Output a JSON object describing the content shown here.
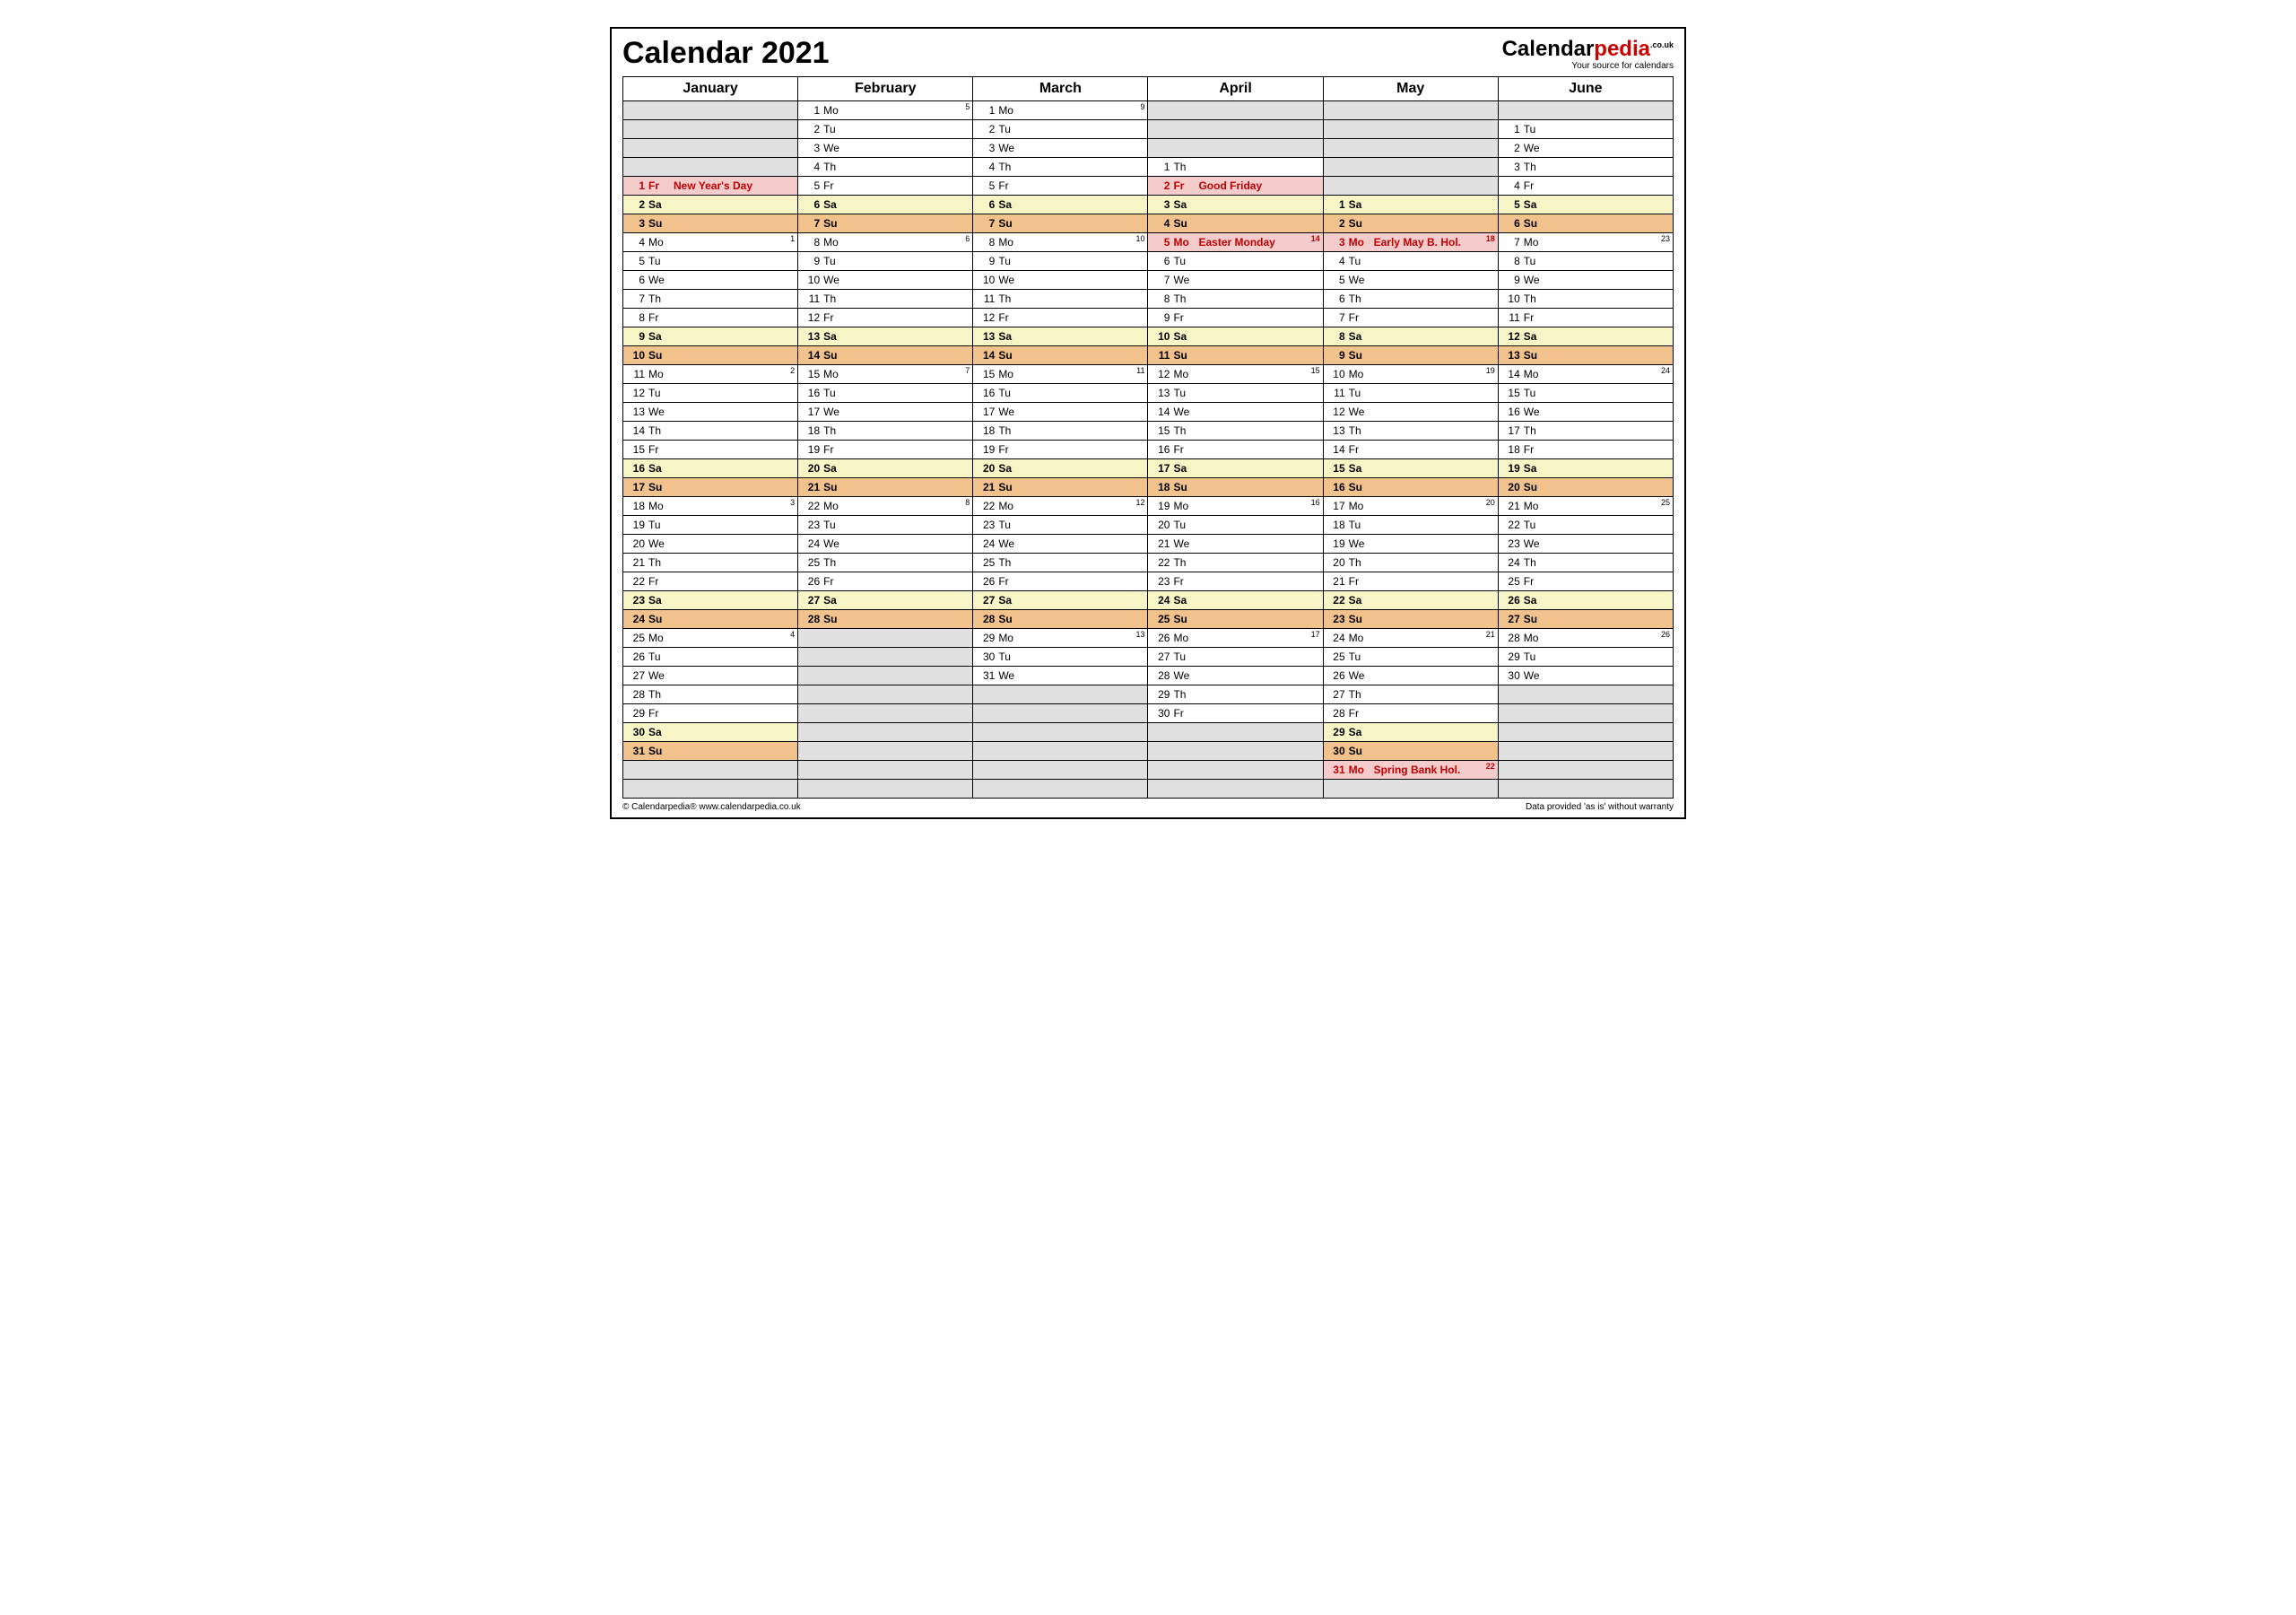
{
  "title": "Calendar 2021",
  "logo": {
    "a": "Calendar",
    "b": "pedia",
    "sup": ".co.uk",
    "tagline": "Your source for calendars"
  },
  "footer_left": "© Calendarpedia®   www.calendarpedia.co.uk",
  "footer_right": "Data provided 'as is' without warranty",
  "months": [
    "January",
    "February",
    "March",
    "April",
    "May",
    "June"
  ],
  "dow": [
    "Mo",
    "Tu",
    "We",
    "Th",
    "Fr",
    "Sa",
    "Su"
  ],
  "rows": 37,
  "start_dow": [
    4,
    0,
    0,
    3,
    5,
    1
  ],
  "days_in_month": [
    31,
    28,
    31,
    30,
    31,
    30
  ],
  "weeknums": {
    "0": {
      "1": "5",
      "2": "9"
    },
    "3": {
      "0": "1"
    },
    "7": {
      "0": "1",
      "1": "6",
      "2": "10",
      "3": "14",
      "4": "18",
      "5": "23"
    },
    "14": {
      "0": "2",
      "1": "7",
      "2": "11",
      "3": "15",
      "4": "19",
      "5": "24"
    },
    "21": {
      "0": "3",
      "1": "8",
      "2": "12",
      "3": "16",
      "4": "20",
      "5": "25"
    },
    "28": {
      "0": "4",
      "2": "13",
      "3": "17",
      "4": "21",
      "5": "26"
    },
    "35": {
      "4": "22"
    }
  },
  "holidays": {
    "0": {
      "1": "New Year's Day"
    },
    "3": {
      "2": "Good Friday",
      "5": "Easter Monday"
    },
    "4": {
      "3": "Early May B. Hol.",
      "31": "Spring Bank Hol."
    }
  }
}
